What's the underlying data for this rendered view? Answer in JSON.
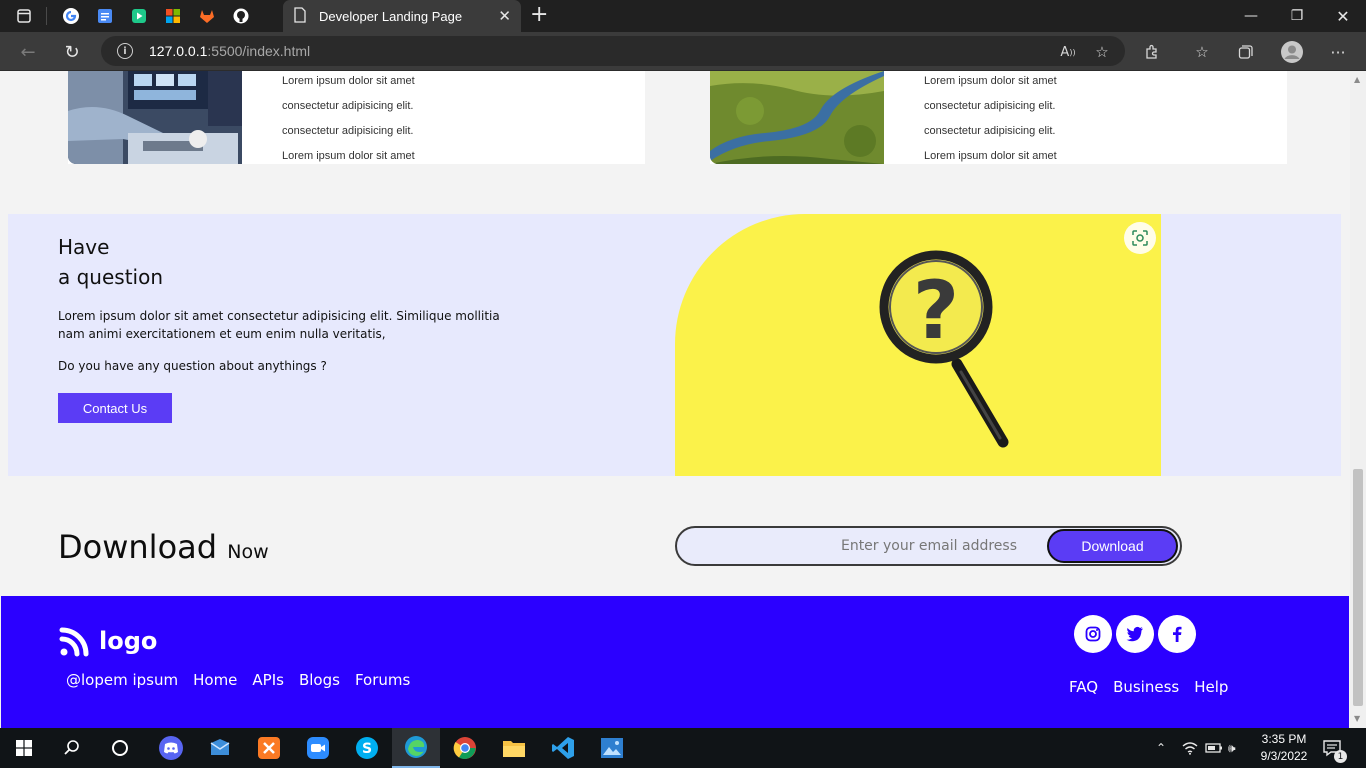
{
  "browser": {
    "active_tab_title": "Developer Landing Page",
    "url_host": "127.0.0.1",
    "url_rest": ":5500/index.html"
  },
  "cards": [
    {
      "lines": [
        "Lorem ipsum dolor sit amet",
        "consectetur adipisicing elit.",
        "consectetur adipisicing elit.",
        "Lorem ipsum dolor sit amet"
      ]
    },
    {
      "lines": [
        "Lorem ipsum dolor sit amet",
        "consectetur adipisicing elit.",
        "consectetur adipisicing elit.",
        "Lorem ipsum dolor sit amet"
      ]
    }
  ],
  "question": {
    "title_line1": "Have",
    "title_line2": "a question",
    "text": "Lorem ipsum dolor sit amet consectetur adipisicing elit. Similique mollitia nam animi exercitationem et eum enim nulla veritatis,",
    "ask": "Do you have any question about anythings ?",
    "contact_label": "Contact Us"
  },
  "download": {
    "title": "Download",
    "title_small": "Now",
    "placeholder": "Enter your email address",
    "button_label": "Download"
  },
  "footer": {
    "logo_text": "logo",
    "links": [
      "@lopem ipsum",
      "Home",
      "APIs",
      "Blogs",
      "Forums"
    ],
    "links_right": [
      "FAQ",
      "Business",
      "Help"
    ],
    "social_icons": [
      "instagram-icon",
      "twitter-icon",
      "facebook-icon"
    ]
  },
  "taskbar": {
    "time": "3:35 PM",
    "date": "9/3/2022",
    "notification_count": "1"
  },
  "colors": {
    "accent": "#5b3cf5",
    "footer_bg": "#2b00ff",
    "question_bg": "#e7e9fd",
    "yellow": "#fbf24a"
  }
}
